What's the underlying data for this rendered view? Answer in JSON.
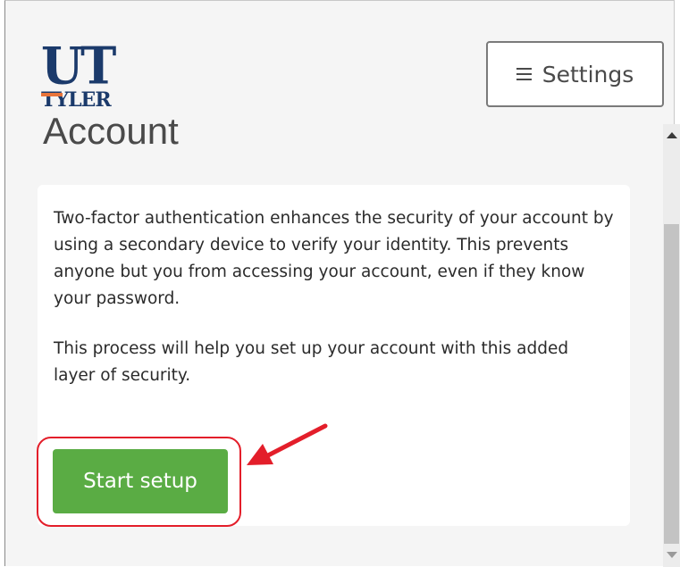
{
  "logo": {
    "line1": "UT",
    "line2": "TYLER"
  },
  "page_title": "Account",
  "settings_button": {
    "label": "Settings",
    "icon": "hamburger-menu-icon"
  },
  "intro": {
    "paragraph1": "Two-factor authentication enhances the security of your account by using a secondary device to verify your identity. This prevents anyone but you from accessing your account, even if they know your password.",
    "paragraph2": "This process will help you set up your account with this added layer of security."
  },
  "start_button": {
    "label": "Start setup",
    "color": "#5aac44"
  },
  "annotation": {
    "ring_color": "#e31e2a",
    "arrow_color": "#e31e2a"
  },
  "brand": {
    "navy": "#1b3a6b",
    "orange": "#e8743b"
  }
}
